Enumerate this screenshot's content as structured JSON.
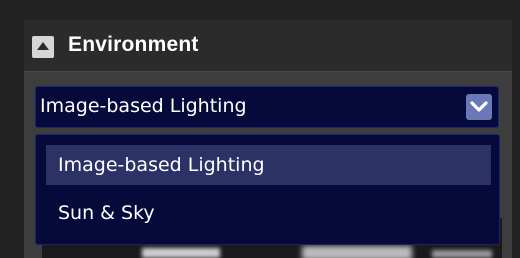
{
  "panel": {
    "title": "Environment",
    "collapse_icon": "triangle-up-icon"
  },
  "lighting_select": {
    "value": "Image-based Lighting",
    "arrow_icon": "chevron-down-icon",
    "options": [
      {
        "label": "Image-based Lighting",
        "selected": true
      },
      {
        "label": "Sun & Sky",
        "selected": false
      }
    ]
  },
  "colors": {
    "dropdown_bg": "#050a3a",
    "highlight": "#2c3166",
    "arrow_button": "#6c77b8"
  }
}
